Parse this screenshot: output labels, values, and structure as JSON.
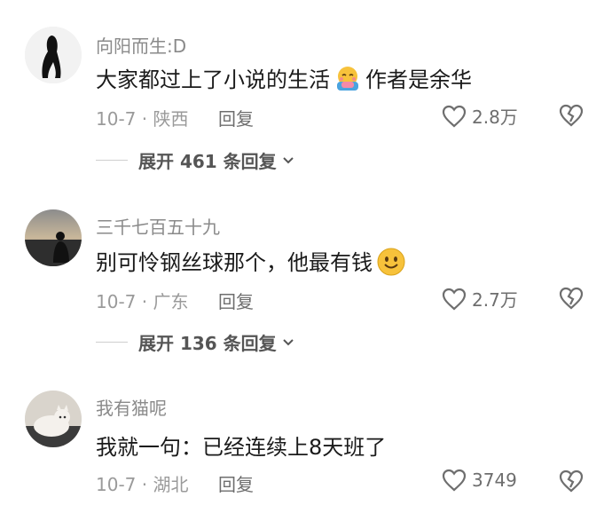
{
  "comments": [
    {
      "username": "向阳而生:D",
      "text_before": "大家都过上了小说的生活",
      "emoji": "hug-emoji",
      "text_after": "作者是余华",
      "date_location": "10-7 · 陕西",
      "reply_label": "回复",
      "likes": "2.8万",
      "expand_label": "展开 461 条回复"
    },
    {
      "username": "三千七百五十九",
      "text_before": "别可怜钢丝球那个，他最有钱",
      "emoji": "smile-emoji",
      "text_after": "",
      "date_location": "10-7 · 广东",
      "reply_label": "回复",
      "likes": "2.7万",
      "expand_label": "展开 136 条回复"
    },
    {
      "username": "我有猫呢",
      "text_before": "我就一句：已经连续上8天班了",
      "text_after": "",
      "date_location": "10-7 · 湖北",
      "reply_label": "回复",
      "likes": "3749"
    }
  ],
  "colors": {
    "meta": "#9a9a9a",
    "text": "#1a1a1a",
    "icon": "#6e6e6e"
  }
}
